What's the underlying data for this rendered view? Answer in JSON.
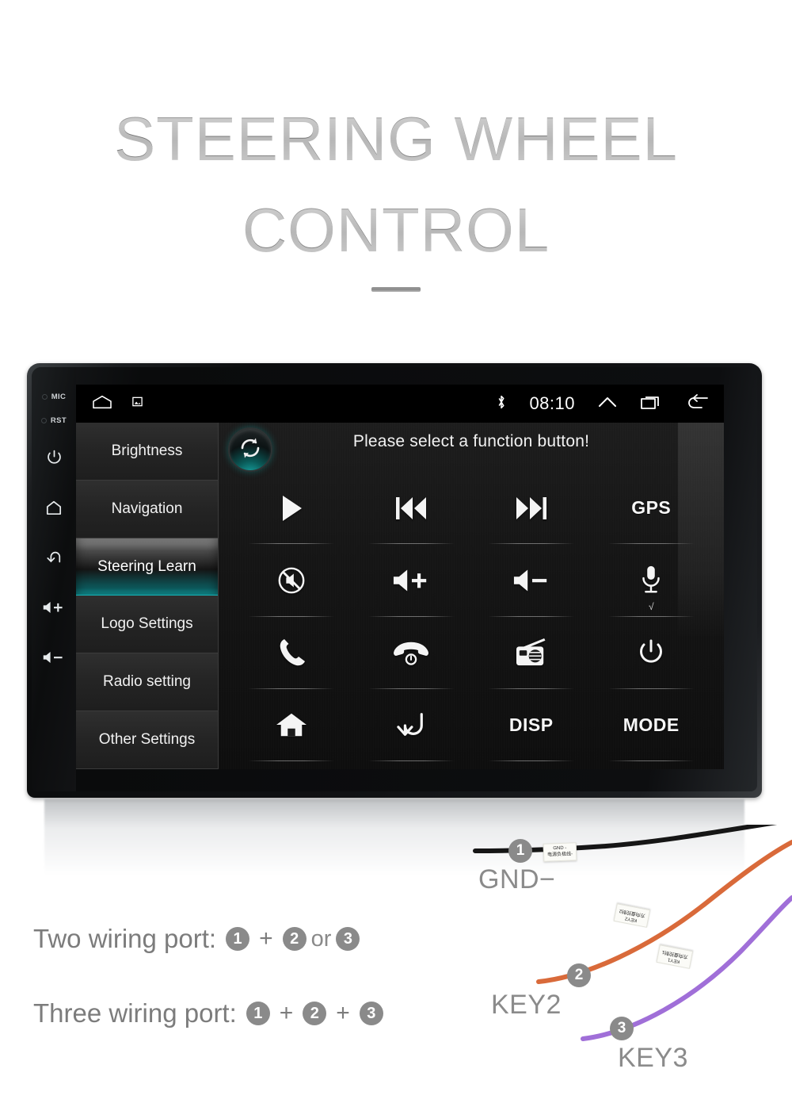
{
  "header": {
    "title_line1": "STEERING WHEEL",
    "title_line2": "CONTROL"
  },
  "device": {
    "side_rail": {
      "mic_label": "MIC",
      "rst_label": "RST",
      "buttons": [
        {
          "name": "power-button",
          "icon": "power-icon"
        },
        {
          "name": "home-button",
          "icon": "home-icon"
        },
        {
          "name": "back-button",
          "icon": "back-icon"
        },
        {
          "name": "volume-up-button",
          "icon": "volume-up-icon",
          "text": "+"
        },
        {
          "name": "volume-down-button",
          "icon": "volume-down-icon",
          "text": "-"
        }
      ]
    },
    "statusbar": {
      "home_icon": "home-icon",
      "screenshot_icon": "screenshot-icon",
      "bluetooth_icon": "bluetooth-icon",
      "clock": "08:10",
      "expand_icon": "chevron-up-icon",
      "recents_icon": "recents-icon",
      "back_icon": "back-arrow-icon"
    },
    "menu": {
      "items": [
        {
          "label": "Brightness",
          "selected": false
        },
        {
          "label": "Navigation",
          "selected": false
        },
        {
          "label": "Steering Learn",
          "selected": true
        },
        {
          "label": "Logo Settings",
          "selected": false
        },
        {
          "label": "Radio setting",
          "selected": false
        },
        {
          "label": "Other Settings",
          "selected": false
        }
      ]
    },
    "panel": {
      "sync_button": "sync-reset-icon",
      "prompt": "Please select a function button!",
      "buttons": [
        {
          "name": "play-button",
          "kind": "icon",
          "icon": "play-icon",
          "label": ""
        },
        {
          "name": "previous-button",
          "kind": "icon",
          "icon": "previous-track-icon",
          "label": ""
        },
        {
          "name": "next-button",
          "kind": "icon",
          "icon": "next-track-icon",
          "label": ""
        },
        {
          "name": "gps-button",
          "kind": "text",
          "icon": "",
          "label": "GPS"
        },
        {
          "name": "mute-button",
          "kind": "icon",
          "icon": "mute-icon",
          "label": ""
        },
        {
          "name": "volume-up-button",
          "kind": "icon",
          "icon": "volume-up-icon",
          "label": ""
        },
        {
          "name": "volume-down-button",
          "kind": "icon",
          "icon": "volume-down-icon",
          "label": ""
        },
        {
          "name": "voice-button",
          "kind": "icon",
          "icon": "microphone-icon",
          "label": "",
          "check": "√"
        },
        {
          "name": "call-answer-button",
          "kind": "icon",
          "icon": "phone-icon",
          "label": ""
        },
        {
          "name": "call-end-button",
          "kind": "icon",
          "icon": "phone-hangup-icon",
          "label": ""
        },
        {
          "name": "radio-button",
          "kind": "icon",
          "icon": "radio-icon",
          "label": ""
        },
        {
          "name": "power-button",
          "kind": "icon",
          "icon": "power-icon",
          "label": ""
        },
        {
          "name": "home-button",
          "kind": "icon",
          "icon": "home-icon",
          "label": ""
        },
        {
          "name": "back-button",
          "kind": "icon",
          "icon": "back-arrow-icon",
          "label": ""
        },
        {
          "name": "disp-button",
          "kind": "text",
          "icon": "",
          "label": "DISP"
        },
        {
          "name": "mode-button",
          "kind": "text",
          "icon": "",
          "label": "MODE"
        }
      ]
    }
  },
  "wiring": {
    "rows": [
      {
        "label": "Two wiring port:",
        "parts": [
          "1",
          "+",
          "2",
          "or",
          "3"
        ]
      },
      {
        "label": "Three wiring port:",
        "parts": [
          "1",
          "+",
          "2",
          "+",
          "3"
        ]
      }
    ],
    "row1_label": "Two wiring port:",
    "row1_n1": "1",
    "row1_plus": "+",
    "row1_n2": "2",
    "row1_or": "or",
    "row1_n3": "3",
    "row2_label": "Three wiring port:",
    "row2_n1": "1",
    "row2_plus1": "+",
    "row2_n2": "2",
    "row2_plus2": "+",
    "row2_n3": "3",
    "wires": [
      {
        "number": "1",
        "name": "GND−",
        "color": "#161616",
        "tag_line1": "GND -",
        "tag_line2": "电源负极线-"
      },
      {
        "number": "2",
        "name": "KEY2",
        "color": "#d96a3a",
        "tag_line1": "KEY2",
        "tag_line2": "方向盘控制2"
      },
      {
        "number": "3",
        "name": "KEY3",
        "color": "#a06fd8",
        "tag_line1": "KEY1",
        "tag_line2": "方向盘控制1"
      }
    ]
  },
  "colors": {
    "accent_teal": "#12a5a8",
    "title_gray": "#7f7f7f",
    "badge_gray": "#8a8a8a"
  }
}
